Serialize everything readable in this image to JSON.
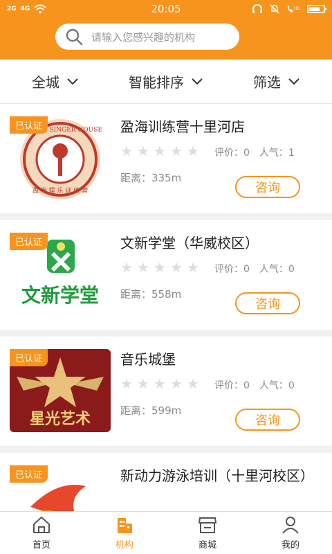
{
  "status_bar": {
    "left": [
      "2G",
      "4G"
    ],
    "time": "20:05"
  },
  "search": {
    "placeholder": "请输入您感兴趣的机构"
  },
  "filters": [
    {
      "label": "全城"
    },
    {
      "label": "智能排序"
    },
    {
      "label": "筛选"
    }
  ],
  "list": [
    {
      "badge": "已认证",
      "name": "盈海训练营十里河店",
      "rating": "评价：0",
      "popularity": "人气：1",
      "distance": "距离：335m",
      "button": "咨询",
      "thumb_text": "YINGHAI SINGER HOUSE",
      "thumb_sub": "盈 海 娱 乐 训 练 营"
    },
    {
      "badge": "已认证",
      "name": "文新学堂（华威校区）",
      "rating": "评价：0",
      "popularity": "人气：0",
      "distance": "距离：558m",
      "button": "咨询",
      "thumb_text": "文新学堂"
    },
    {
      "badge": "已认证",
      "name": "音乐城堡",
      "rating": "评价：0",
      "popularity": "人气：0",
      "distance": "距离：599m",
      "button": "咨询",
      "thumb_text": "星光艺术"
    },
    {
      "badge": "已认证",
      "name": "新动力游泳培训（十里河校区）",
      "rating": "",
      "popularity": "",
      "distance": "",
      "button": ""
    }
  ],
  "tabs": [
    {
      "label": "首页",
      "icon": "home-icon",
      "active": false
    },
    {
      "label": "机构",
      "icon": "building-icon",
      "active": true
    },
    {
      "label": "商城",
      "icon": "store-icon",
      "active": false
    },
    {
      "label": "我的",
      "icon": "user-icon",
      "active": false
    }
  ],
  "colors": {
    "accent": "#f7941d"
  }
}
